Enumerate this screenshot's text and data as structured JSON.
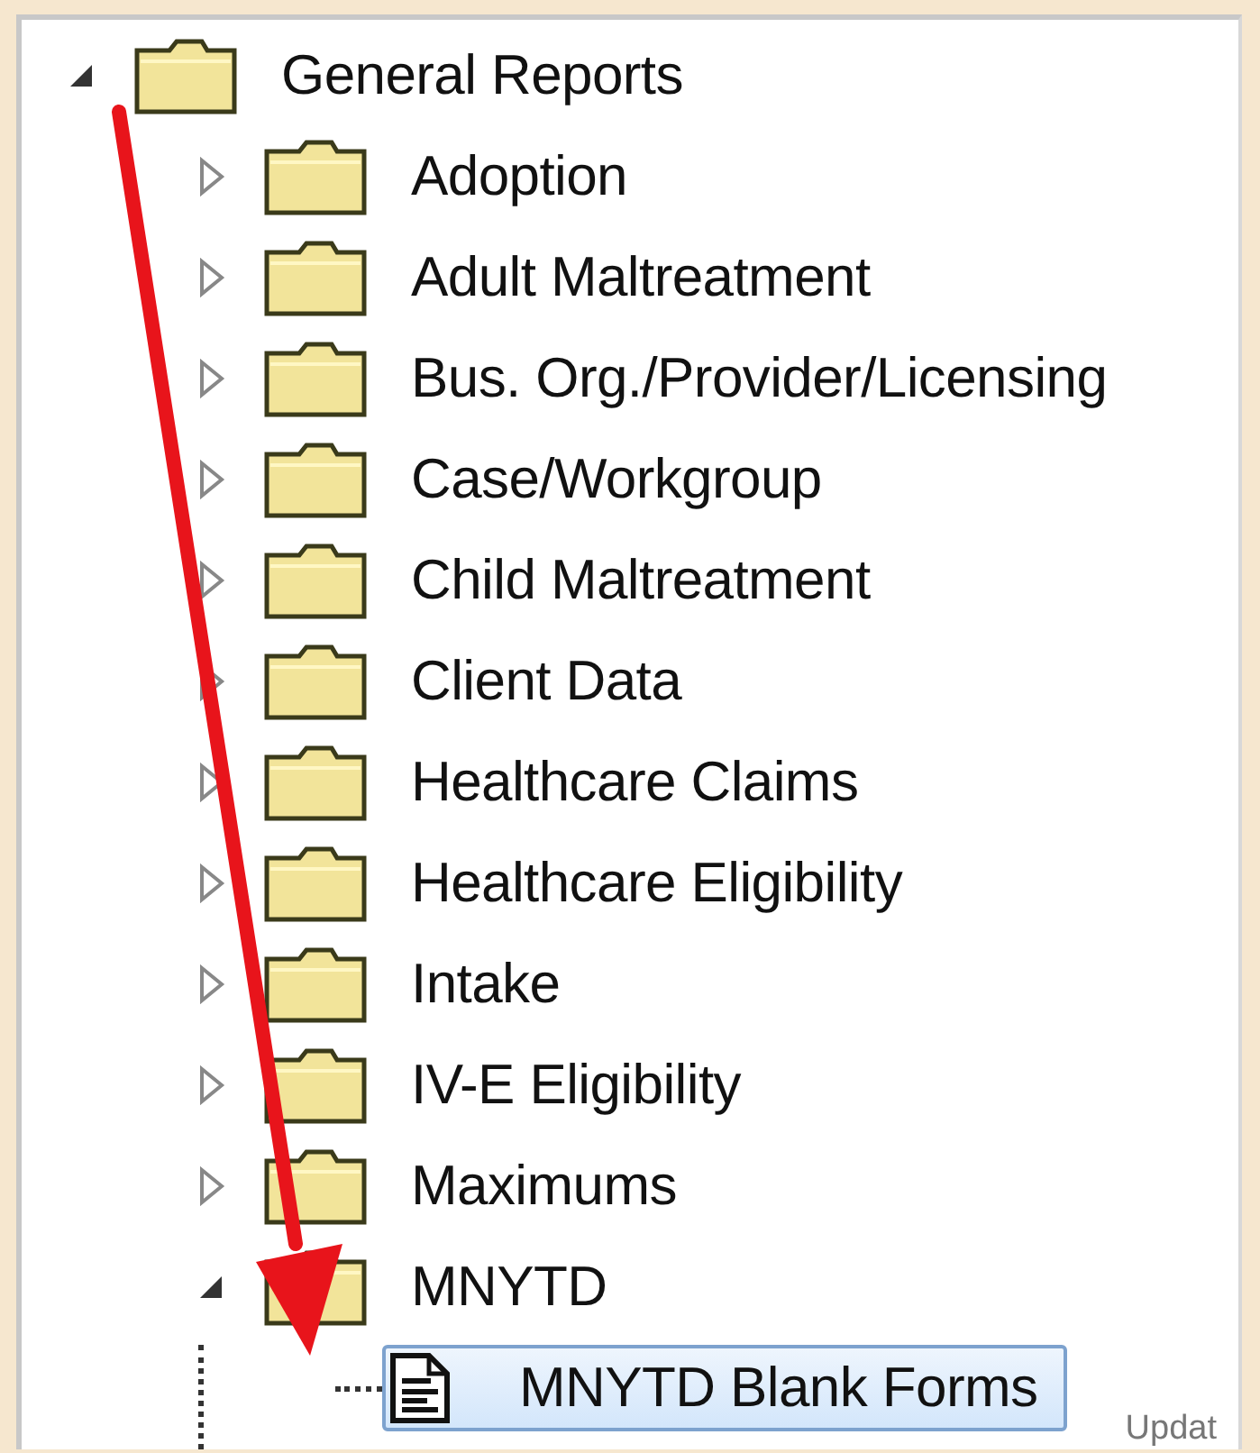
{
  "tree": [
    {
      "label": "General Reports",
      "kind": "folder",
      "expanded": true,
      "selected": false,
      "children": [
        {
          "label": "Adoption",
          "kind": "folder",
          "expanded": false,
          "selected": false
        },
        {
          "label": "Adult Maltreatment",
          "kind": "folder",
          "expanded": false,
          "selected": false
        },
        {
          "label": "Bus. Org./Provider/Licensing",
          "kind": "folder",
          "expanded": false,
          "selected": false
        },
        {
          "label": "Case/Workgroup",
          "kind": "folder",
          "expanded": false,
          "selected": false
        },
        {
          "label": "Child Maltreatment",
          "kind": "folder",
          "expanded": false,
          "selected": false
        },
        {
          "label": "Client Data",
          "kind": "folder",
          "expanded": false,
          "selected": false
        },
        {
          "label": "Healthcare Claims",
          "kind": "folder",
          "expanded": false,
          "selected": false
        },
        {
          "label": "Healthcare Eligibility",
          "kind": "folder",
          "expanded": false,
          "selected": false
        },
        {
          "label": "Intake",
          "kind": "folder",
          "expanded": false,
          "selected": false
        },
        {
          "label": "IV-E Eligibility",
          "kind": "folder",
          "expanded": false,
          "selected": false
        },
        {
          "label": "Maximums",
          "kind": "folder",
          "expanded": false,
          "selected": false
        },
        {
          "label": "MNYTD",
          "kind": "folder",
          "expanded": true,
          "selected": false,
          "children": [
            {
              "label": "MNYTD Blank Forms",
              "kind": "document",
              "selected": true
            }
          ]
        }
      ]
    }
  ],
  "footer_text": "Updat"
}
